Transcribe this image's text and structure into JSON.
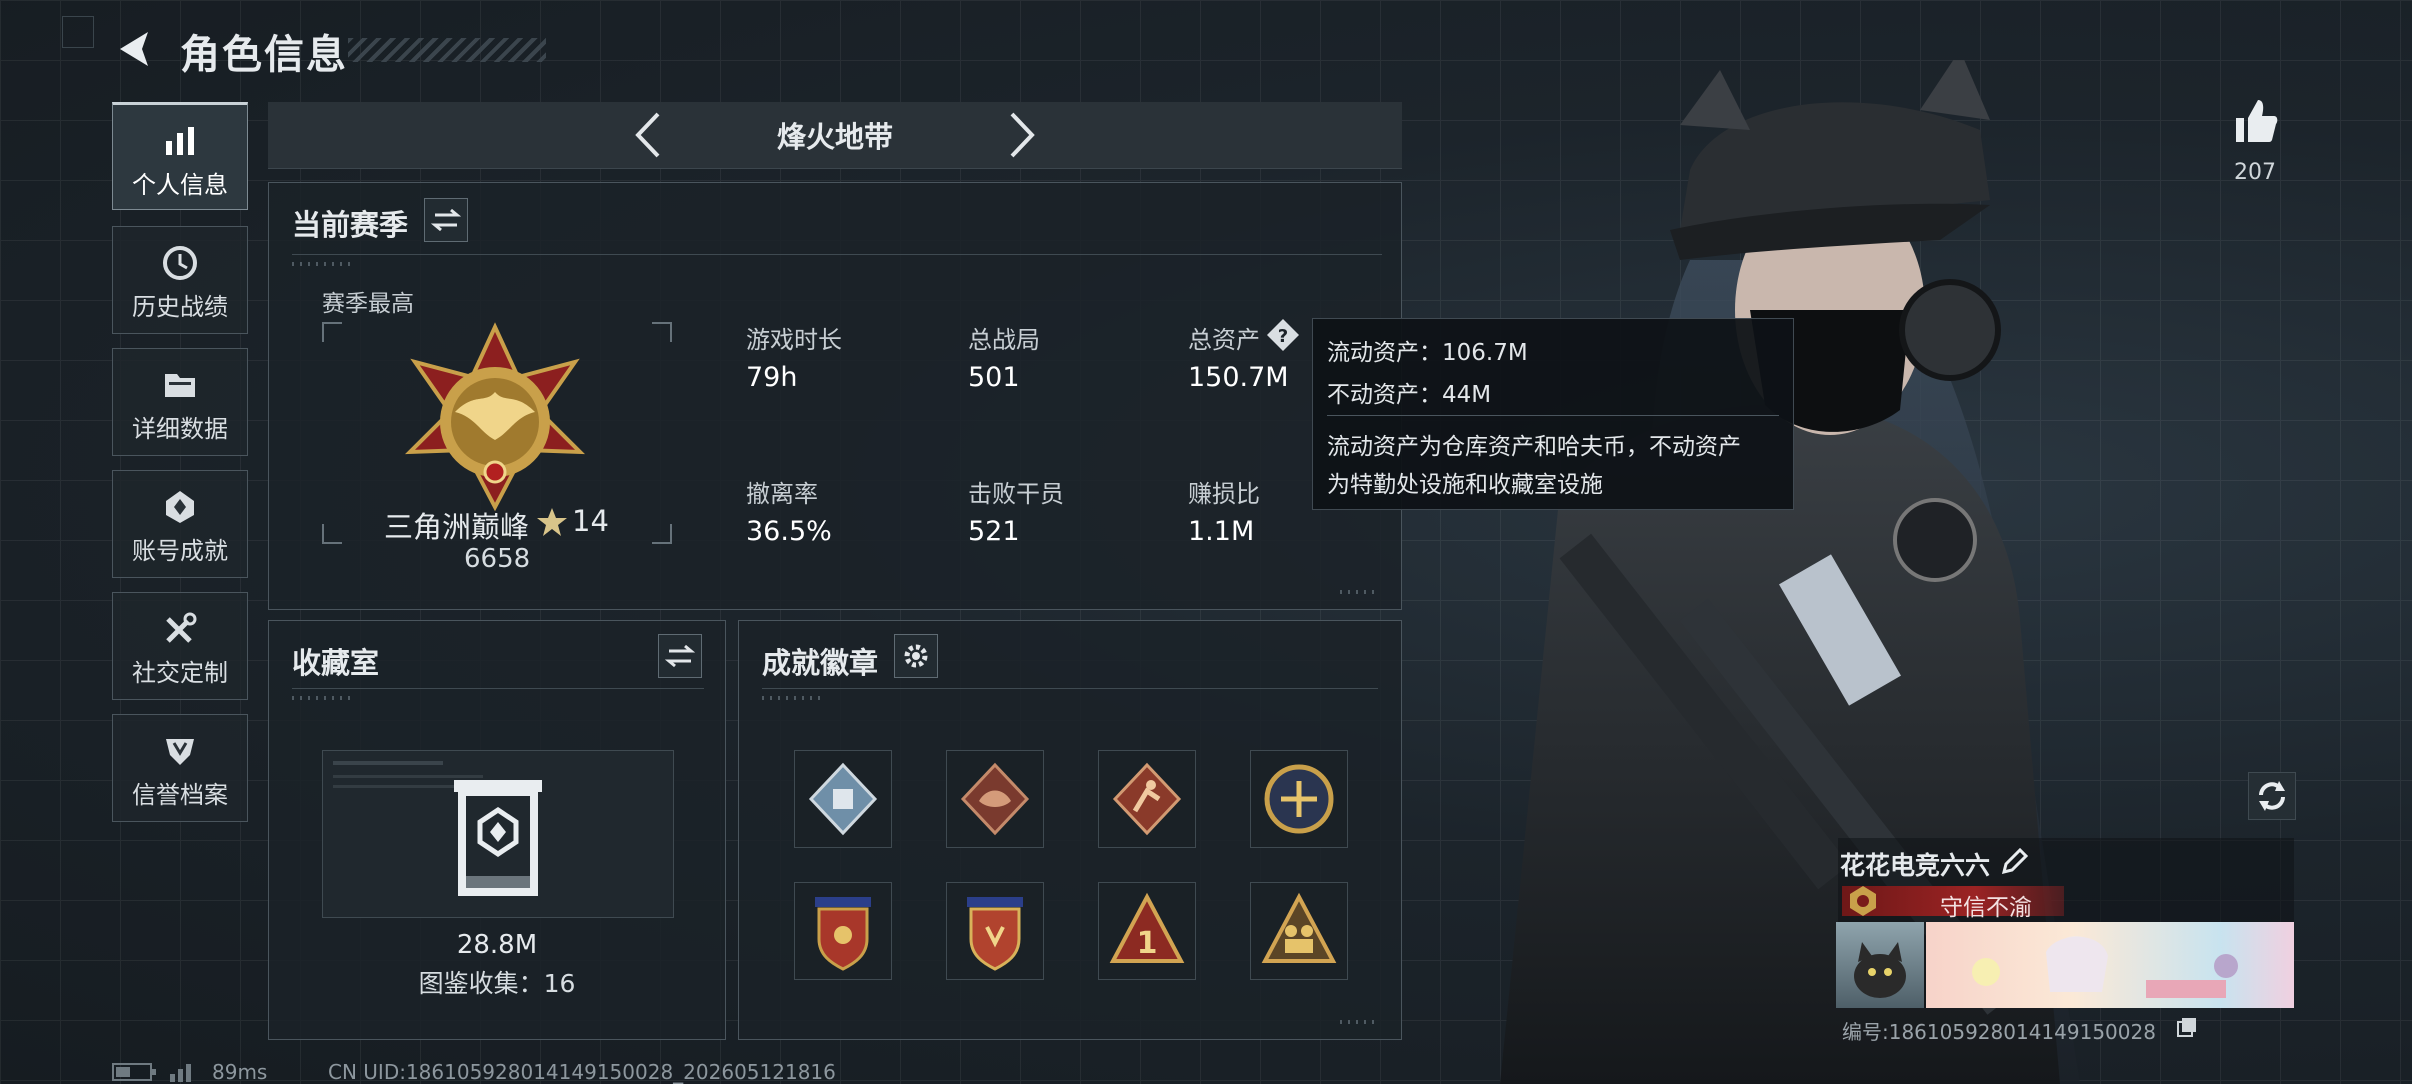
{
  "header": {
    "title": "角色信息"
  },
  "sidebar": {
    "items": [
      {
        "label": "个人信息",
        "icon": "bar-chart-icon"
      },
      {
        "label": "历史战绩",
        "icon": "history-clock-icon"
      },
      {
        "label": "详细数据",
        "icon": "folder-icon"
      },
      {
        "label": "账号成就",
        "icon": "achievement-icon"
      },
      {
        "label": "社交定制",
        "icon": "tools-icon"
      },
      {
        "label": "信誉档案",
        "icon": "shield-icon"
      }
    ]
  },
  "map": {
    "name": "烽火地带"
  },
  "season": {
    "title": "当前赛季",
    "best_label": "赛季最高",
    "rank_name": "三角洲巅峰",
    "rank_stars": "14",
    "rank_score": "6658",
    "stats": [
      {
        "label": "游戏时长",
        "value": "79h"
      },
      {
        "label": "总战局",
        "value": "501"
      },
      {
        "label": "总资产",
        "value": "150.7M"
      },
      {
        "label": "撤离率",
        "value": "36.5%"
      },
      {
        "label": "击败干员",
        "value": "521"
      },
      {
        "label": "赚损比",
        "value": "1.1M"
      }
    ]
  },
  "tooltip": {
    "liquid": "流动资产：106.7M",
    "fixed": "不动资产：44M",
    "desc1": "流动资产为仓库资产和哈夫币，不动资产",
    "desc2": "为特勤处设施和收藏室设施"
  },
  "collection": {
    "title": "收藏室",
    "value": "28.8M",
    "catalog": "图鉴收集：16"
  },
  "badges": {
    "title": "成就徽章",
    "items": [
      "badge-1",
      "badge-2",
      "badge-3",
      "badge-4",
      "badge-5",
      "badge-6",
      "badge-7",
      "badge-8"
    ]
  },
  "right": {
    "likes": "207",
    "player_name": "花花电竞六六",
    "player_tag": "守信不渝",
    "player_id": "编号:1861059280141491500​28"
  },
  "footer": {
    "ping": "89ms",
    "uid": "CN UID:18610592801414915002​8_202605121816"
  },
  "colors": {
    "accent_red": "#8c1f1f",
    "panel_border": "#4a555d",
    "badge_gold": "#c9a04a"
  }
}
